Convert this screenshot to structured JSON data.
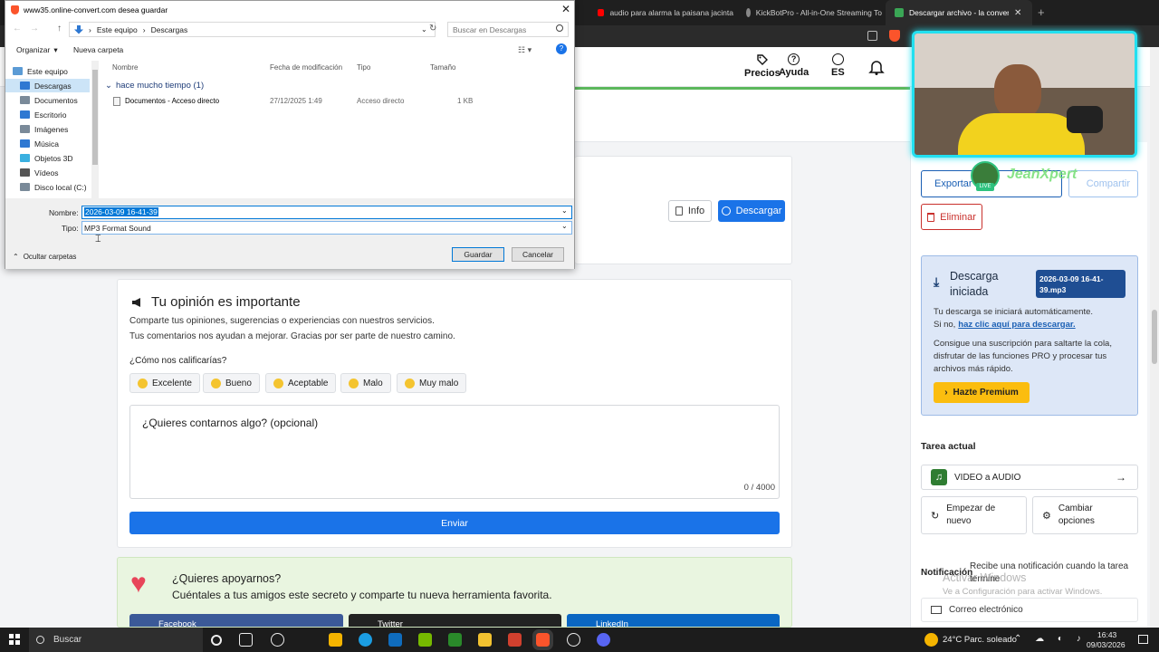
{
  "browser": {
    "tabs": [
      {
        "label": "audio para alarma la paisana jacinta",
        "icon": "youtube-icon",
        "color": "#ff0000"
      },
      {
        "label": "KickBotPro - All-in-One Streaming To",
        "icon": "kickbot-icon",
        "color": "#888888"
      },
      {
        "label": "Descargar archivo - la conversión...",
        "icon": "online-convert-icon",
        "color": "#3aa655"
      }
    ]
  },
  "site": {
    "header": {
      "pricing": "Precios",
      "help": "Ayuda",
      "lang": "ES"
    },
    "actions": {
      "info": "Info",
      "download": "Descargar"
    },
    "feedback": {
      "title": "Tu opinión es importante",
      "line1": "Comparte tus opiniones, sugerencias o experiencias con nuestros servicios.",
      "line2": "Tus comentarios nos ayudan a mejorar. Gracias por ser parte de nuestro camino.",
      "rate_question": "¿Cómo nos calificarías?",
      "ratings": [
        "Excelente",
        "Bueno",
        "Aceptable",
        "Malo",
        "Muy malo"
      ],
      "textarea_label": "¿Quieres contarnos algo? (opcional)",
      "counter": "0 / 4000",
      "submit": "Enviar"
    },
    "support": {
      "title": "¿Quieres apoyarnos?",
      "subtitle": "Cuéntales a tus amigos este secreto y comparte tu nueva herramienta favorita.",
      "buttons": [
        "Facebook",
        "Twitter",
        "LinkedIn"
      ]
    },
    "sidebar": {
      "export": "Exportar",
      "share": "Compartir",
      "delete": "Eliminar",
      "download_started": "Descarga iniciada",
      "filename_badge": "2026-03-09 16-41-39.mp3",
      "auto_text": "Tu descarga se iniciará automáticamente.",
      "if_not": "Si no,",
      "click_link": "haz clic aquí para descargar.",
      "premium_text": "Consigue una suscripción para saltarte la cola, disfrutar de las funciones PRO y procesar tus archivos más rápido.",
      "premium_btn": "Hazte Premium",
      "current_task": "Tarea actual",
      "task": "VIDEO a AUDIO",
      "restart": "Empezar de nuevo",
      "change_options": "Cambiar opciones",
      "notification": "Notificación",
      "notification_text": "Recibe una notificación cuando la tarea termine",
      "email": "Correo electrónico"
    },
    "overlay": {
      "streamer": "JeanXpert",
      "live": "LIVE",
      "activate_title": "Activar Windows",
      "activate_sub": "Ve a Configuración para activar Windows."
    }
  },
  "dialog": {
    "title": "www35.online-convert.com desea guardar",
    "breadcrumb": [
      "Este equipo",
      "Descargas"
    ],
    "search_placeholder": "Buscar en Descargas",
    "organize": "Organizar",
    "new_folder": "Nueva carpeta",
    "sidebar": [
      {
        "label": "Este equipo",
        "color": "#5b9bd5"
      },
      {
        "label": "Descargas",
        "color": "#2e78d2"
      },
      {
        "label": "Documentos",
        "color": "#7a8a99"
      },
      {
        "label": "Escritorio",
        "color": "#2e78d2"
      },
      {
        "label": "Imágenes",
        "color": "#7a8a99"
      },
      {
        "label": "Música",
        "color": "#2e78d2"
      },
      {
        "label": "Objetos 3D",
        "color": "#3ab0e0"
      },
      {
        "label": "Vídeos",
        "color": "#555555"
      },
      {
        "label": "Disco local (C:)",
        "color": "#7a8a99"
      }
    ],
    "columns": {
      "name": "Nombre",
      "modified": "Fecha de modificación",
      "type": "Tipo",
      "size": "Tamaño"
    },
    "group": "hace mucho tiempo (1)",
    "file": {
      "name": "Documentos - Acceso directo",
      "modified": "27/12/2025 1:49",
      "type": "Acceso directo",
      "size": "1 KB"
    },
    "name_label": "Nombre:",
    "name_value": "2026-03-09 16-41-39",
    "type_label": "Tipo:",
    "type_value": "MP3 Format Sound",
    "hide_folders": "Ocultar carpetas",
    "save": "Guardar",
    "cancel": "Cancelar"
  },
  "taskbar": {
    "search": "Buscar",
    "weather": "24°C  Parc. soleado",
    "time": "16:43",
    "date": "09/03/2026"
  }
}
